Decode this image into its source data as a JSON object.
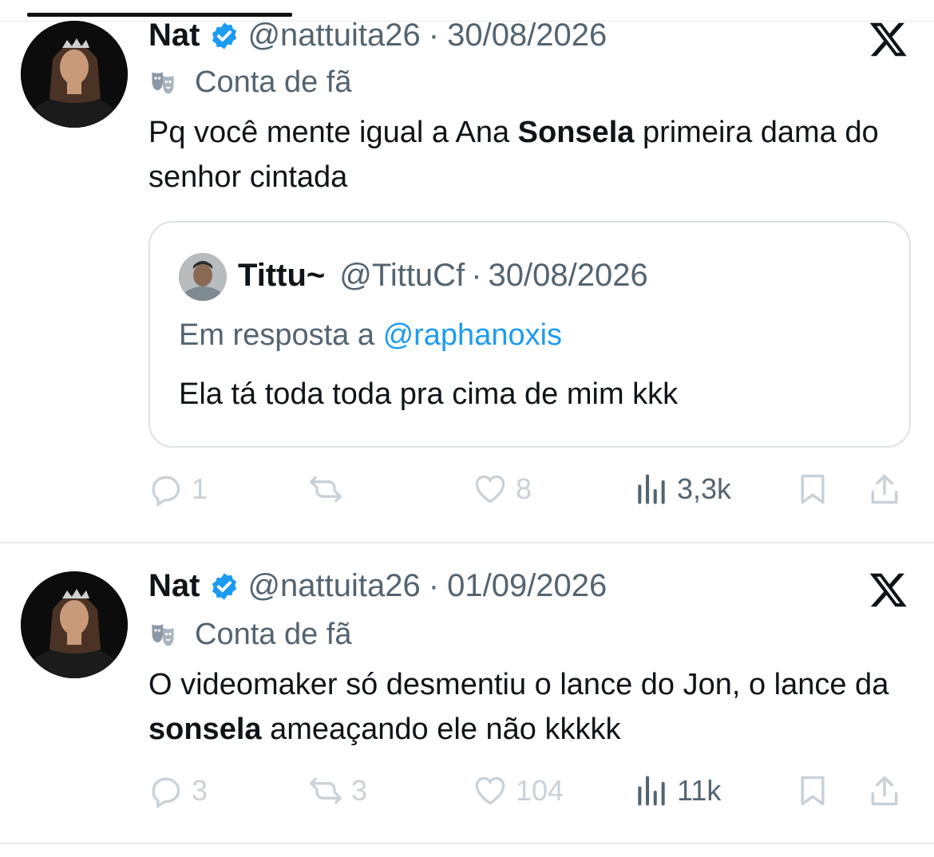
{
  "tweets": [
    {
      "name": "Nat",
      "handle": "@nattuita26",
      "separator": "·",
      "date": "30/08/2026",
      "label": "Conta de fã",
      "text_1": "Pq você mente igual a Ana ",
      "text_bold": "Sonsela",
      "text_2": " primeira dama do senhor cintada",
      "quote": {
        "name": "Tittu~",
        "handle": "@TittuCf",
        "separator": "·",
        "date": "30/08/2026",
        "reply_prefix": "Em resposta a ",
        "reply_link": "@raphanoxis",
        "text": "Ela tá toda toda pra cima de mim kkk"
      },
      "replies": "1",
      "reposts": "",
      "likes": "8",
      "views": "3,3k"
    },
    {
      "name": "Nat",
      "handle": "@nattuita26",
      "separator": "·",
      "date": "01/09/2026",
      "label": "Conta de fã",
      "text_1": "O videomaker só desmentiu o lance do Jon, o lance da ",
      "text_bold": "sonsela",
      "text_2": " ameaçando ele não kkkkk",
      "replies": "3",
      "reposts": "3",
      "likes": "104",
      "views": "11k"
    }
  ],
  "icons": {
    "verified": "verified-badge-icon",
    "x_logo": "x-logo-icon",
    "mask": "theater-mask-icon",
    "reply": "reply-icon",
    "repost": "repost-icon",
    "like": "heart-icon",
    "views": "views-icon",
    "bookmark": "bookmark-icon",
    "share": "share-icon"
  },
  "colors": {
    "verified": "#1d9bf0",
    "link": "#1d9bf0",
    "secondary_text": "#536471",
    "faded_action": "#c9d1d8"
  }
}
